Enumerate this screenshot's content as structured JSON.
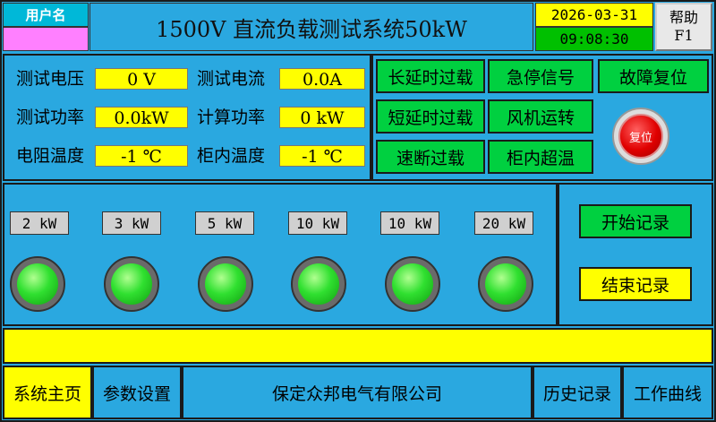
{
  "header": {
    "user_label": "用户名",
    "user_value": "",
    "title": "1500V 直流负载测试系统50kW",
    "date": "2026-03-31",
    "time": "09:08:30",
    "help_line1": "帮助",
    "help_line2": "F1"
  },
  "measurements": {
    "test_voltage_label": "测试电压",
    "test_voltage_value": "0 V",
    "test_current_label": "测试电流",
    "test_current_value": "0.0A",
    "test_power_label": "测试功率",
    "test_power_value": "0.0kW",
    "calc_power_label": "计算功率",
    "calc_power_value": "0 kW",
    "resistor_temp_label": "电阻温度",
    "resistor_temp_value": "-1 ℃",
    "cabinet_temp_label": "柜内温度",
    "cabinet_temp_value": "-1 ℃"
  },
  "alarms": {
    "long_delay_overload": "长延时过载",
    "emergency_stop": "急停信号",
    "short_delay_overload": "短延时过载",
    "fan_running": "风机运转",
    "instant_overload": "速断过载",
    "cabinet_overtemp": "柜内超温"
  },
  "reset": {
    "fault_reset_label": "故障复位",
    "reset_button_text": "复位"
  },
  "loads": [
    {
      "label": "2 kW"
    },
    {
      "label": "3 kW"
    },
    {
      "label": "5 kW"
    },
    {
      "label": "10 kW"
    },
    {
      "label": "10 kW"
    },
    {
      "label": "20 kW"
    }
  ],
  "recording": {
    "start_label": "开始记录",
    "end_label": "结束记录"
  },
  "message_bar": "",
  "nav": {
    "home": "系统主页",
    "params": "参数设置",
    "company": "保定众邦电气有限公司",
    "history": "历史记录",
    "curve": "工作曲线"
  },
  "colors": {
    "background": "#2aa8e0",
    "value_yellow": "#ffff00",
    "indicator_green": "#00d040",
    "user_field_pink": "#ff80ff",
    "reset_red": "#e00000"
  }
}
